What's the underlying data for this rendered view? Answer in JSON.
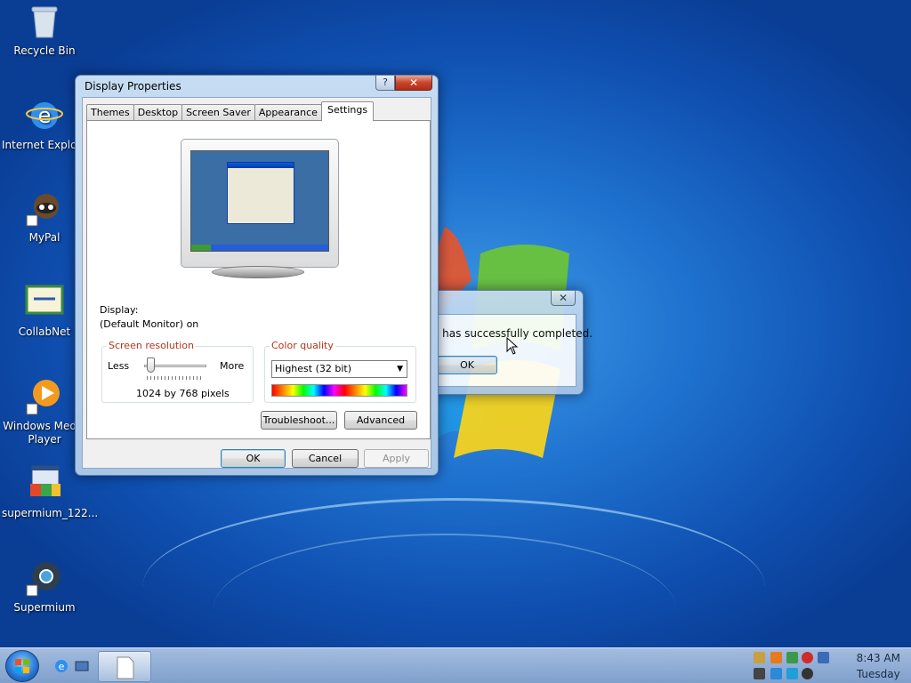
{
  "desktop": {
    "icons": [
      {
        "label": "Recycle Bin"
      },
      {
        "label": "Internet Explorer"
      },
      {
        "label": "MyPal"
      },
      {
        "label": "CollabNet"
      },
      {
        "label": "Windows Media Player"
      },
      {
        "label": "supermium_122..."
      },
      {
        "label": "Supermium"
      }
    ]
  },
  "display_properties": {
    "title": "Display Properties",
    "help_label": "?",
    "close_label": "✕",
    "tabs": [
      {
        "label": "Themes"
      },
      {
        "label": "Desktop"
      },
      {
        "label": "Screen Saver"
      },
      {
        "label": "Appearance"
      },
      {
        "label": "Settings"
      }
    ],
    "display_label": "Display:",
    "display_value": "(Default Monitor) on",
    "resolution": {
      "title": "Screen resolution",
      "less": "Less",
      "more": "More",
      "value": "1024 by 768 pixels",
      "slider_fraction": 0.05
    },
    "color_quality": {
      "title": "Color quality",
      "selected": "Highest (32 bit)"
    },
    "buttons": {
      "troubleshoot": "Troubleshoot...",
      "advanced": "Advanced",
      "ok": "OK",
      "cancel": "Cancel",
      "apply": "Apply"
    }
  },
  "message_dialog": {
    "close_label": "✕",
    "message": "o has successfully completed.",
    "ok": "OK"
  },
  "taskbar": {
    "time": "8:43 AM",
    "day": "Tuesday"
  }
}
